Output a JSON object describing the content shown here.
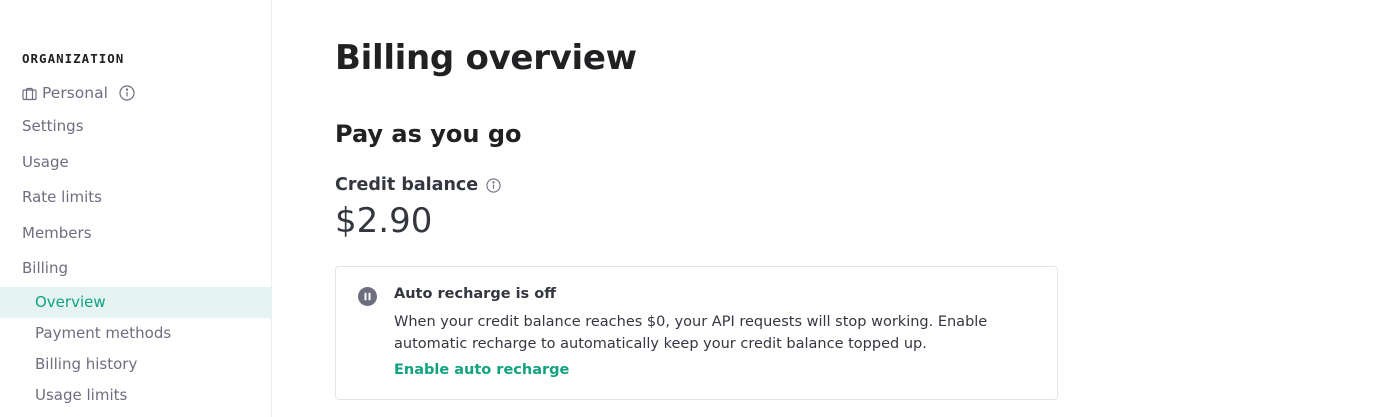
{
  "sidebar": {
    "heading": "ORGANIZATION",
    "org_name": "Personal",
    "items": {
      "settings": "Settings",
      "usage": "Usage",
      "rate_limits": "Rate limits",
      "members": "Members",
      "billing": "Billing"
    },
    "billing_sub": {
      "overview": "Overview",
      "payment_methods": "Payment methods",
      "billing_history": "Billing history",
      "usage_limits": "Usage limits"
    },
    "active_item": "Overview"
  },
  "main": {
    "title": "Billing overview",
    "section_title": "Pay as you go",
    "credit_label": "Credit balance",
    "credit_value": "$2.90",
    "notice": {
      "title": "Auto recharge is off",
      "body": "When your credit balance reaches $0, your API requests will stop working. Enable automatic recharge to automatically keep your credit balance topped up.",
      "link": "Enable auto recharge"
    }
  },
  "colors": {
    "accent": "#10a37f",
    "active_bg": "#e6f3f3",
    "muted_text": "#6e6e80"
  },
  "icons": {
    "org": "briefcase-icon",
    "info": "info-icon",
    "notice": "pause-icon"
  }
}
